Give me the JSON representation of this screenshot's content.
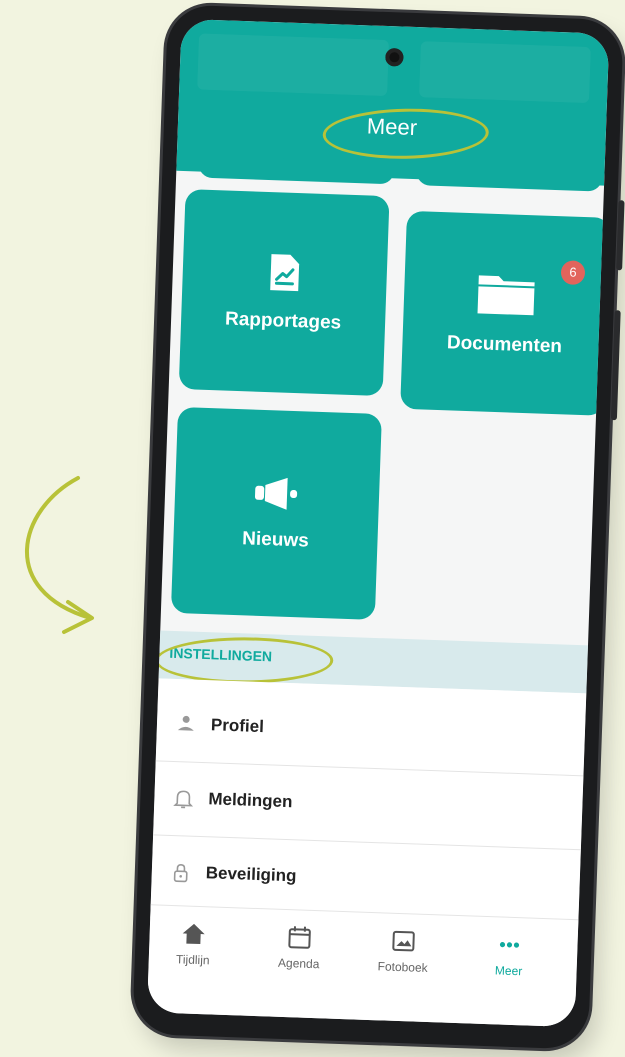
{
  "header": {
    "title": "Meer"
  },
  "tiles": [
    {
      "label": "Rapportages",
      "icon": "report-chart-icon"
    },
    {
      "label": "Documenten",
      "icon": "folder-icon",
      "badge": "6"
    },
    {
      "label": "Nieuws",
      "icon": "megaphone-icon"
    }
  ],
  "settings": {
    "section_label": "INSTELLINGEN",
    "items": [
      {
        "label": "Profiel",
        "icon": "person-icon"
      },
      {
        "label": "Meldingen",
        "icon": "bell-icon"
      },
      {
        "label": "Beveiliging",
        "icon": "lock-icon"
      }
    ]
  },
  "tabbar": {
    "items": [
      {
        "label": "Tijdlijn",
        "icon": "home-icon"
      },
      {
        "label": "Agenda",
        "icon": "calendar-icon"
      },
      {
        "label": "Fotoboek",
        "icon": "photo-icon"
      },
      {
        "label": "Meer",
        "icon": "more-dots-icon",
        "active": true
      }
    ]
  },
  "colors": {
    "accent": "#10aa9e",
    "highlight": "#b8c238",
    "badge": "#e2645c",
    "background": "#f2f4e0"
  }
}
